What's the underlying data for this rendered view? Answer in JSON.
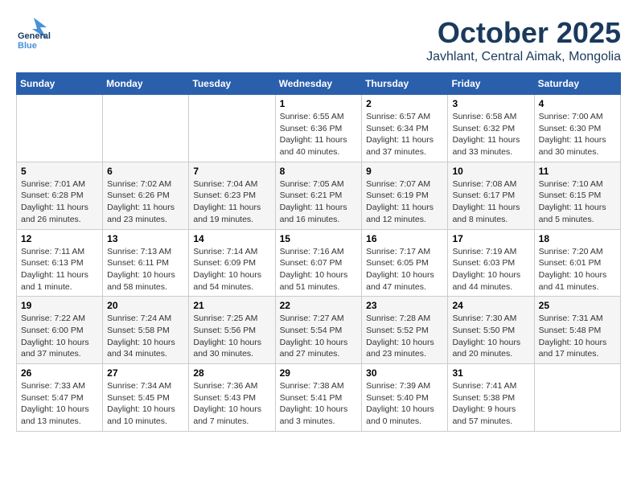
{
  "header": {
    "logo_general": "General",
    "logo_blue": "Blue",
    "month": "October 2025",
    "location": "Javhlant, Central Aimak, Mongolia"
  },
  "weekdays": [
    "Sunday",
    "Monday",
    "Tuesday",
    "Wednesday",
    "Thursday",
    "Friday",
    "Saturday"
  ],
  "weeks": [
    [
      {
        "day": "",
        "info": ""
      },
      {
        "day": "",
        "info": ""
      },
      {
        "day": "",
        "info": ""
      },
      {
        "day": "1",
        "info": "Sunrise: 6:55 AM\nSunset: 6:36 PM\nDaylight: 11 hours\nand 40 minutes."
      },
      {
        "day": "2",
        "info": "Sunrise: 6:57 AM\nSunset: 6:34 PM\nDaylight: 11 hours\nand 37 minutes."
      },
      {
        "day": "3",
        "info": "Sunrise: 6:58 AM\nSunset: 6:32 PM\nDaylight: 11 hours\nand 33 minutes."
      },
      {
        "day": "4",
        "info": "Sunrise: 7:00 AM\nSunset: 6:30 PM\nDaylight: 11 hours\nand 30 minutes."
      }
    ],
    [
      {
        "day": "5",
        "info": "Sunrise: 7:01 AM\nSunset: 6:28 PM\nDaylight: 11 hours\nand 26 minutes."
      },
      {
        "day": "6",
        "info": "Sunrise: 7:02 AM\nSunset: 6:26 PM\nDaylight: 11 hours\nand 23 minutes."
      },
      {
        "day": "7",
        "info": "Sunrise: 7:04 AM\nSunset: 6:23 PM\nDaylight: 11 hours\nand 19 minutes."
      },
      {
        "day": "8",
        "info": "Sunrise: 7:05 AM\nSunset: 6:21 PM\nDaylight: 11 hours\nand 16 minutes."
      },
      {
        "day": "9",
        "info": "Sunrise: 7:07 AM\nSunset: 6:19 PM\nDaylight: 11 hours\nand 12 minutes."
      },
      {
        "day": "10",
        "info": "Sunrise: 7:08 AM\nSunset: 6:17 PM\nDaylight: 11 hours\nand 8 minutes."
      },
      {
        "day": "11",
        "info": "Sunrise: 7:10 AM\nSunset: 6:15 PM\nDaylight: 11 hours\nand 5 minutes."
      }
    ],
    [
      {
        "day": "12",
        "info": "Sunrise: 7:11 AM\nSunset: 6:13 PM\nDaylight: 11 hours\nand 1 minute."
      },
      {
        "day": "13",
        "info": "Sunrise: 7:13 AM\nSunset: 6:11 PM\nDaylight: 10 hours\nand 58 minutes."
      },
      {
        "day": "14",
        "info": "Sunrise: 7:14 AM\nSunset: 6:09 PM\nDaylight: 10 hours\nand 54 minutes."
      },
      {
        "day": "15",
        "info": "Sunrise: 7:16 AM\nSunset: 6:07 PM\nDaylight: 10 hours\nand 51 minutes."
      },
      {
        "day": "16",
        "info": "Sunrise: 7:17 AM\nSunset: 6:05 PM\nDaylight: 10 hours\nand 47 minutes."
      },
      {
        "day": "17",
        "info": "Sunrise: 7:19 AM\nSunset: 6:03 PM\nDaylight: 10 hours\nand 44 minutes."
      },
      {
        "day": "18",
        "info": "Sunrise: 7:20 AM\nSunset: 6:01 PM\nDaylight: 10 hours\nand 41 minutes."
      }
    ],
    [
      {
        "day": "19",
        "info": "Sunrise: 7:22 AM\nSunset: 6:00 PM\nDaylight: 10 hours\nand 37 minutes."
      },
      {
        "day": "20",
        "info": "Sunrise: 7:24 AM\nSunset: 5:58 PM\nDaylight: 10 hours\nand 34 minutes."
      },
      {
        "day": "21",
        "info": "Sunrise: 7:25 AM\nSunset: 5:56 PM\nDaylight: 10 hours\nand 30 minutes."
      },
      {
        "day": "22",
        "info": "Sunrise: 7:27 AM\nSunset: 5:54 PM\nDaylight: 10 hours\nand 27 minutes."
      },
      {
        "day": "23",
        "info": "Sunrise: 7:28 AM\nSunset: 5:52 PM\nDaylight: 10 hours\nand 23 minutes."
      },
      {
        "day": "24",
        "info": "Sunrise: 7:30 AM\nSunset: 5:50 PM\nDaylight: 10 hours\nand 20 minutes."
      },
      {
        "day": "25",
        "info": "Sunrise: 7:31 AM\nSunset: 5:48 PM\nDaylight: 10 hours\nand 17 minutes."
      }
    ],
    [
      {
        "day": "26",
        "info": "Sunrise: 7:33 AM\nSunset: 5:47 PM\nDaylight: 10 hours\nand 13 minutes."
      },
      {
        "day": "27",
        "info": "Sunrise: 7:34 AM\nSunset: 5:45 PM\nDaylight: 10 hours\nand 10 minutes."
      },
      {
        "day": "28",
        "info": "Sunrise: 7:36 AM\nSunset: 5:43 PM\nDaylight: 10 hours\nand 7 minutes."
      },
      {
        "day": "29",
        "info": "Sunrise: 7:38 AM\nSunset: 5:41 PM\nDaylight: 10 hours\nand 3 minutes."
      },
      {
        "day": "30",
        "info": "Sunrise: 7:39 AM\nSunset: 5:40 PM\nDaylight: 10 hours\nand 0 minutes."
      },
      {
        "day": "31",
        "info": "Sunrise: 7:41 AM\nSunset: 5:38 PM\nDaylight: 9 hours\nand 57 minutes."
      },
      {
        "day": "",
        "info": ""
      }
    ]
  ]
}
